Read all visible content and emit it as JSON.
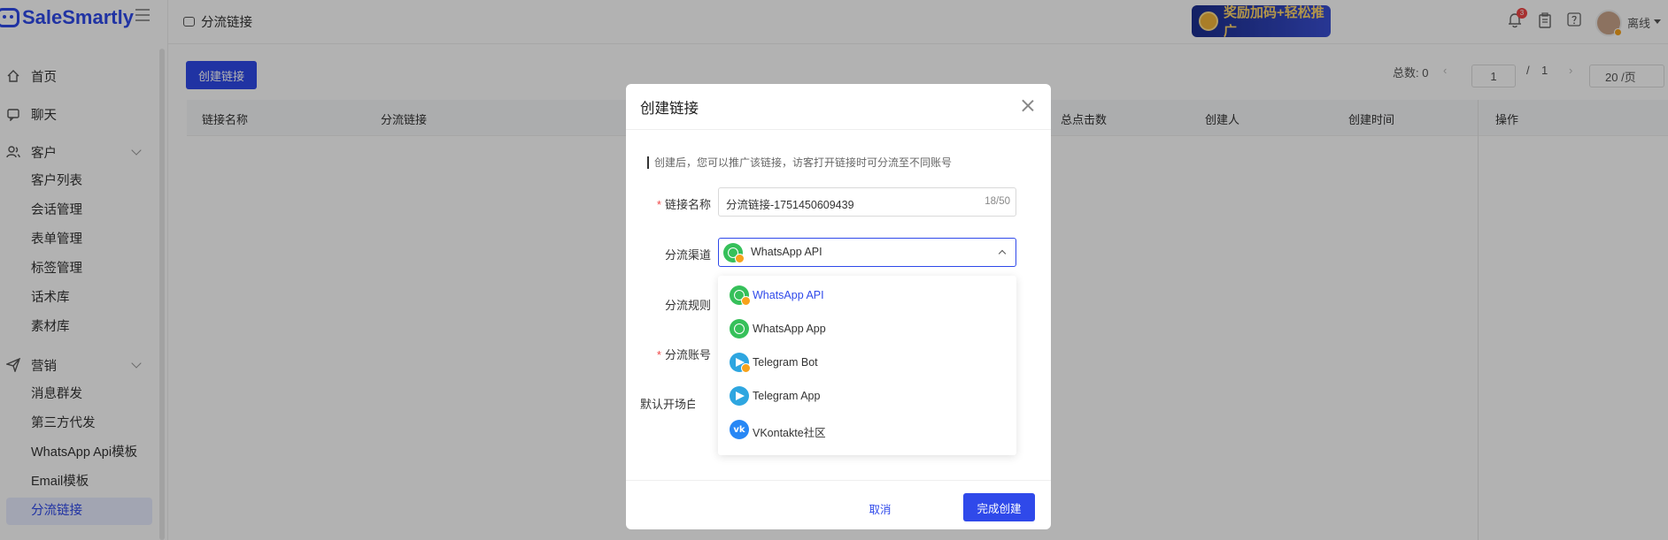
{
  "app": {
    "logo_text": "SaleSmartly"
  },
  "header": {
    "breadcrumb": "分流链接",
    "promo_text": "奖励加码+轻松推广",
    "notification_count": "3",
    "status": "离线"
  },
  "sidebar": {
    "items": [
      {
        "label": "首页"
      },
      {
        "label": "聊天"
      },
      {
        "label": "客户"
      },
      {
        "label": "客户列表"
      },
      {
        "label": "会话管理"
      },
      {
        "label": "表单管理"
      },
      {
        "label": "标签管理"
      },
      {
        "label": "话术库"
      },
      {
        "label": "素材库"
      },
      {
        "label": "营销"
      },
      {
        "label": "消息群发"
      },
      {
        "label": "第三方代发"
      },
      {
        "label": "WhatsApp Api模板"
      },
      {
        "label": "Email模板"
      },
      {
        "label": "分流链接"
      }
    ]
  },
  "toolbar": {
    "create_label": "创建链接",
    "total_label": "总数: 0",
    "page_current": "1",
    "page_sep": "/",
    "page_total": "1",
    "page_size": "20 /页"
  },
  "table": {
    "columns": [
      "链接名称",
      "分流链接",
      "总点击数",
      "创建人",
      "创建时间",
      "操作"
    ]
  },
  "modal": {
    "title": "创建链接",
    "hint": "创建后，您可以推广该链接，访客打开链接时可分流至不同账号",
    "labels": {
      "name": "链接名称",
      "channel": "分流渠道",
      "rule": "分流规则",
      "account": "分流账号",
      "greeting": "默认开场白"
    },
    "name_value": "分流链接-1751450609439",
    "name_counter": "18/50",
    "channel_value": "WhatsApp API",
    "options": [
      {
        "label": "WhatsApp API",
        "icon": "whatsapp-api-icon",
        "selected": true
      },
      {
        "label": "WhatsApp App",
        "icon": "whatsapp-icon",
        "selected": false
      },
      {
        "label": "Telegram Bot",
        "icon": "telegram-bot-icon",
        "selected": false
      },
      {
        "label": "Telegram App",
        "icon": "telegram-icon",
        "selected": false
      },
      {
        "label": "VKontakte社区",
        "icon": "vk-icon",
        "selected": false
      }
    ],
    "cancel_label": "取消",
    "confirm_label": "完成创建"
  },
  "colors": {
    "primary": "#2f49ea",
    "required": "#f04646",
    "whatsapp": "#36c05a",
    "telegram": "#2ea6e0",
    "vk": "#2787f5"
  }
}
